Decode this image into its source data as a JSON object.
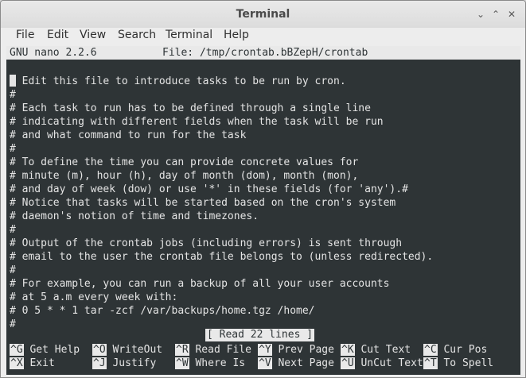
{
  "window": {
    "title": "Terminal",
    "controls": [
      "minimize",
      "maximize",
      "close"
    ]
  },
  "menu": [
    "File",
    "Edit",
    "View",
    "Search",
    "Terminal",
    "Help"
  ],
  "nano": {
    "version": "GNU nano 2.2.6",
    "file_label": "File: /tmp/crontab.bBZepH/crontab",
    "lines": [
      "# Edit this file to introduce tasks to be run by cron.",
      "#",
      "# Each task to run has to be defined through a single line",
      "# indicating with different fields when the task will be run",
      "# and what command to run for the task",
      "#",
      "# To define the time you can provide concrete values for",
      "# minute (m), hour (h), day of month (dom), month (mon),",
      "# and day of week (dow) or use '*' in these fields (for 'any').#",
      "# Notice that tasks will be started based on the cron's system",
      "# daemon's notion of time and timezones.",
      "#",
      "# Output of the crontab jobs (including errors) is sent through",
      "# email to the user the crontab file belongs to (unless redirected).",
      "#",
      "# For example, you can run a backup of all your user accounts",
      "# at 5 a.m every week with:",
      "# 0 5 * * 1 tar -zcf /var/backups/home.tgz /home/",
      "#"
    ],
    "status": "[ Read 22 lines ]",
    "shortcuts": [
      [
        {
          "key": "^G",
          "label": "Get Help"
        },
        {
          "key": "^O",
          "label": "WriteOut"
        },
        {
          "key": "^R",
          "label": "Read File"
        },
        {
          "key": "^Y",
          "label": "Prev Page"
        },
        {
          "key": "^K",
          "label": "Cut Text"
        },
        {
          "key": "^C",
          "label": "Cur Pos"
        }
      ],
      [
        {
          "key": "^X",
          "label": "Exit"
        },
        {
          "key": "^J",
          "label": "Justify"
        },
        {
          "key": "^W",
          "label": "Where Is"
        },
        {
          "key": "^V",
          "label": "Next Page"
        },
        {
          "key": "^U",
          "label": "UnCut Text"
        },
        {
          "key": "^T",
          "label": "To Spell"
        }
      ]
    ]
  }
}
